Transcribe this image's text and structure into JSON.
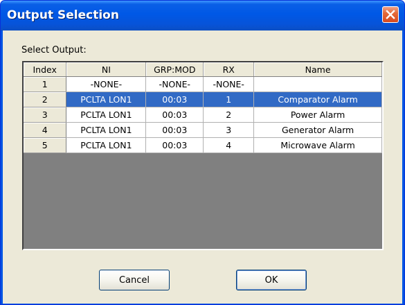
{
  "window": {
    "title": "Output Selection",
    "close_glyph": "✕"
  },
  "dialog": {
    "select_label": "Select Output:"
  },
  "table": {
    "headers": [
      "Index",
      "NI",
      "GRP:MOD",
      "RX",
      "Name"
    ],
    "selected_row_index": 1,
    "rows": [
      [
        "1",
        "-NONE-",
        "-NONE-",
        "-NONE-",
        ""
      ],
      [
        "2",
        "PCLTA LON1",
        "00:03",
        "1",
        "Comparator Alarm"
      ],
      [
        "3",
        "PCLTA LON1",
        "00:03",
        "2",
        "Power Alarm"
      ],
      [
        "4",
        "PCLTA LON1",
        "00:03",
        "3",
        "Generator Alarm"
      ],
      [
        "5",
        "PCLTA LON1",
        "00:03",
        "4",
        "Microwave Alarm"
      ]
    ]
  },
  "buttons": {
    "cancel_label": "Cancel",
    "ok_label": "OK"
  },
  "colors": {
    "titlebar": "#0058e6",
    "dialog_bg": "#ece9d8",
    "selection": "#316ac5",
    "grid_empty": "#808080",
    "close_button": "#d9491e"
  }
}
